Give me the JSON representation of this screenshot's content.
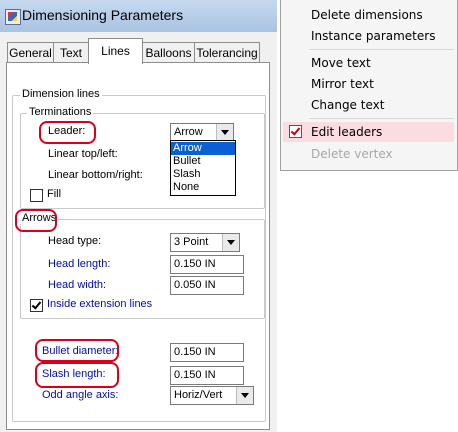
{
  "dialog": {
    "title": "Dimensioning Parameters",
    "tabs": [
      "General",
      "Text",
      "Lines",
      "Balloons",
      "Tolerancing"
    ],
    "active_tab": "Lines",
    "dimension_lines": {
      "group_label": "Dimension lines",
      "terminations": {
        "group_label": "Terminations",
        "leader_label": "Leader:",
        "leader_value": "Arrow",
        "leader_options": [
          "Arrow",
          "Bullet",
          "Slash",
          "None"
        ],
        "linear_top_left_label": "Linear top/left:",
        "linear_bottom_right_label": "Linear bottom/right:",
        "fill_label": "Fill",
        "fill_checked": false
      },
      "arrows": {
        "group_label": "Arrows",
        "head_type_label": "Head type:",
        "head_type_value": "3 Point",
        "head_length_label": "Head length:",
        "head_length_value": "0.150 IN",
        "head_width_label": "Head width:",
        "head_width_value": "0.050 IN",
        "inside_ext_label": "Inside extension lines",
        "inside_ext_checked": true
      },
      "bullet_diameter_label": "Bullet diameter:",
      "bullet_diameter_value": "0.150 IN",
      "slash_length_label": "Slash length:",
      "slash_length_value": "0.150 IN",
      "odd_angle_label": "Odd angle axis:",
      "odd_angle_value": "Horiz/Vert"
    }
  },
  "context_menu": {
    "items": [
      {
        "label": "Delete dimensions",
        "enabled": true
      },
      {
        "label": "Instance parameters",
        "enabled": true
      },
      {
        "label": "Move text",
        "enabled": true
      },
      {
        "label": "Mirror text",
        "enabled": true
      },
      {
        "label": "Change text",
        "enabled": true
      },
      {
        "label": "Edit leaders",
        "enabled": true,
        "checked": true
      },
      {
        "label": "Delete vertex",
        "enabled": false
      }
    ]
  },
  "colors": {
    "highlight_ring": "#d8001c",
    "blue_label": "#000fa0",
    "selected_option": "#0a5fd5",
    "menu_checked_bg": "#fbdde1"
  }
}
